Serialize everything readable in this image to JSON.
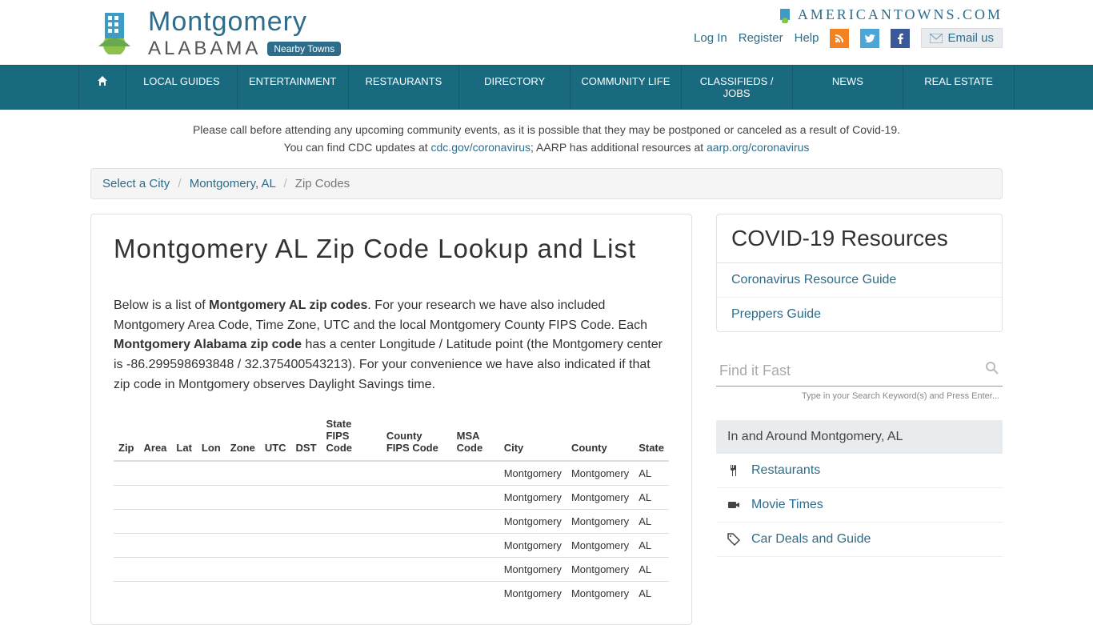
{
  "brand": {
    "city": "Montgomery",
    "state": "ALABAMA",
    "nearby": "Nearby Towns"
  },
  "site_name": "AMERICANTOWNS.COM",
  "top_links": {
    "login": "Log In",
    "register": "Register",
    "help": "Help",
    "email": "Email us"
  },
  "nav": [
    "LOCAL GUIDES",
    "ENTERTAINMENT",
    "RESTAURANTS",
    "DIRECTORY",
    "COMMUNITY LIFE",
    "CLASSIFIEDS / JOBS",
    "NEWS",
    "REAL ESTATE"
  ],
  "notice": {
    "line1": "Please call before attending any upcoming community events, as it is possible that they may be postponed or canceled as a result of Covid-19.",
    "line2a": "You can find CDC updates at ",
    "link1": "cdc.gov/coronavirus",
    "line2b": "; AARP has additional resources at ",
    "link2": "aarp.org/coronavirus"
  },
  "breadcrumb": {
    "a": "Select a City",
    "b": "Montgomery, AL",
    "c": "Zip Codes"
  },
  "page": {
    "h1": "Montgomery AL Zip Code Lookup and List",
    "intro_before_bold1": "Below is a list of ",
    "bold1": "Montgomery AL zip codes",
    "intro_mid": ". For your research we have also included Montgomery Area Code, Time Zone, UTC and the local Montgomery County FIPS Code. Each ",
    "bold2": "Montgomery Alabama zip code",
    "intro_after": " has a center Longitude / Latitude point (the Montgomery center is -86.299598693848 / 32.375400543213). For your convenience we have also indicated if that zip code in Montgomery observes Daylight Savings time."
  },
  "table": {
    "headers": [
      "Zip",
      "Area",
      "Lat",
      "Lon",
      "Zone",
      "UTC",
      "DST",
      "State FIPS Code",
      "County FIPS Code",
      "MSA Code",
      "City",
      "County",
      "State"
    ],
    "rows": [
      {
        "city": "Montgomery",
        "county": "Montgomery",
        "state": "AL"
      },
      {
        "city": "Montgomery",
        "county": "Montgomery",
        "state": "AL"
      },
      {
        "city": "Montgomery",
        "county": "Montgomery",
        "state": "AL"
      },
      {
        "city": "Montgomery",
        "county": "Montgomery",
        "state": "AL"
      },
      {
        "city": "Montgomery",
        "county": "Montgomery",
        "state": "AL"
      },
      {
        "city": "Montgomery",
        "county": "Montgomery",
        "state": "AL"
      }
    ]
  },
  "covid_panel": {
    "title": "COVID-19 Resources",
    "links": [
      "Coronavirus Resource Guide",
      "Preppers Guide"
    ]
  },
  "search": {
    "placeholder": "Find it Fast",
    "hint": "Type in your Search Keyword(s) and Press Enter..."
  },
  "around": {
    "title": "In and Around Montgomery, AL",
    "items": [
      {
        "icon": "fork",
        "label": "Restaurants"
      },
      {
        "icon": "camera",
        "label": "Movie Times"
      },
      {
        "icon": "tag",
        "label": "Car Deals and Guide"
      }
    ]
  }
}
